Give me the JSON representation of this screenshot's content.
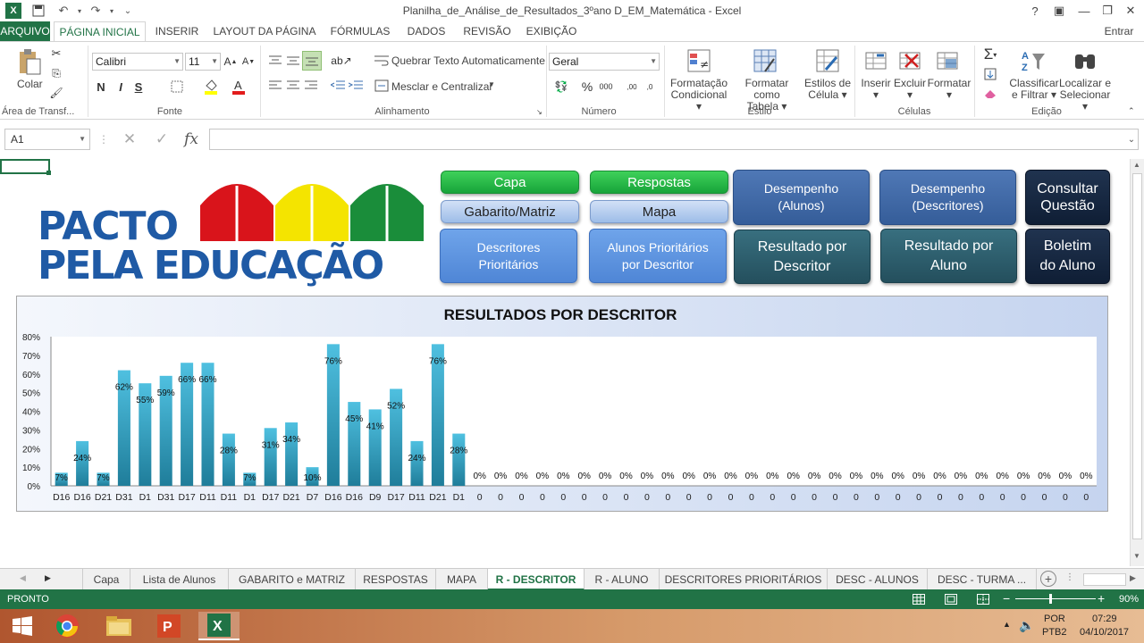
{
  "window": {
    "title": "Planilha_de_Análise_de_Resultados_3ºano D_EM_Matemática - Excel",
    "help": "?",
    "signin": "Entrar"
  },
  "ribbon_tabs": [
    "ARQUIVO",
    "PÁGINA INICIAL",
    "INSERIR",
    "LAYOUT DA PÁGINA",
    "FÓRMULAS",
    "DADOS",
    "REVISÃO",
    "EXIBIÇÃO"
  ],
  "ribbon": {
    "paste": "Colar",
    "font_name": "Calibri",
    "font_size": "11",
    "bold": "N",
    "italic": "I",
    "underline": "S",
    "wrap_text": "Quebrar Texto Automaticamente",
    "merge_center": "Mesclar e Centralizar",
    "number_format": "Geral",
    "percent": "%",
    "thousands": "000",
    "cond_format": [
      "Formatação",
      "Condicional"
    ],
    "format_table": [
      "Formatar como",
      "Tabela"
    ],
    "cell_styles": [
      "Estilos de",
      "Célula"
    ],
    "insert": "Inserir",
    "delete": "Excluir",
    "format": "Formatar",
    "sort_filter": [
      "Classificar",
      "e Filtrar"
    ],
    "find_select": [
      "Localizar e",
      "Selecionar"
    ],
    "groups": [
      "Área de Transf...",
      "Fonte",
      "Alinhamento",
      "Número",
      "Estilo",
      "Células",
      "Edição"
    ]
  },
  "formula_bar": {
    "name_box": "A1",
    "fx": "fx",
    "value": ""
  },
  "logo": {
    "line1": "PACTO",
    "line2": "PELA EDUCAÇÃO"
  },
  "nav_buttons": {
    "capa": "Capa",
    "respostas": "Respostas",
    "gabarito": "Gabarito/Matriz",
    "mapa": "Mapa",
    "desc_prior": [
      "Descritores",
      "Prioritários"
    ],
    "alunos_prior": [
      "Alunos Prioritários",
      "por Descritor"
    ],
    "desemp_alunos": [
      "Desempenho",
      "(Alunos)"
    ],
    "desemp_desc": [
      "Desempenho",
      "(Descritores)"
    ],
    "consultar": [
      "Consultar",
      "Questão"
    ],
    "res_desc": [
      "Resultado por",
      "Descritor"
    ],
    "res_aluno": [
      "Resultado por",
      "Aluno"
    ],
    "boletim": [
      "Boletim",
      "do Aluno"
    ]
  },
  "chart_data": {
    "type": "bar",
    "title": "RESULTADOS POR DESCRITOR",
    "categories": [
      "D16",
      "D16",
      "D21",
      "D31",
      "D1",
      "D31",
      "D17",
      "D11",
      "D11",
      "D1",
      "D17",
      "D21",
      "D7",
      "D16",
      "D16",
      "D9",
      "D17",
      "D11",
      "D21",
      "D1",
      "0",
      "0",
      "0",
      "0",
      "0",
      "0",
      "0",
      "0",
      "0",
      "0",
      "0",
      "0",
      "0",
      "0",
      "0",
      "0",
      "0",
      "0",
      "0",
      "0",
      "0",
      "0",
      "0",
      "0",
      "0",
      "0",
      "0",
      "0",
      "0",
      "0"
    ],
    "values": [
      7,
      24,
      7,
      62,
      55,
      59,
      66,
      66,
      28,
      7,
      31,
      34,
      10,
      76,
      45,
      41,
      52,
      24,
      76,
      28,
      0,
      0,
      0,
      0,
      0,
      0,
      0,
      0,
      0,
      0,
      0,
      0,
      0,
      0,
      0,
      0,
      0,
      0,
      0,
      0,
      0,
      0,
      0,
      0,
      0,
      0,
      0,
      0,
      0,
      0
    ],
    "labels": [
      "7%",
      "24%",
      "7%",
      "62%",
      "55%",
      "59%",
      "66%",
      "66%",
      "28%",
      "7%",
      "31%",
      "34%",
      "10%",
      "76%",
      "45%",
      "41%",
      "52%",
      "24%",
      "76%",
      "28%",
      "0%",
      "0%",
      "0%",
      "0%",
      "0%",
      "0%",
      "0%",
      "0%",
      "0%",
      "0%",
      "0%",
      "0%",
      "0%",
      "0%",
      "0%",
      "0%",
      "0%",
      "0%",
      "0%",
      "0%",
      "0%",
      "0%",
      "0%",
      "0%",
      "0%",
      "0%",
      "0%",
      "0%",
      "0%",
      "0%"
    ],
    "ylim": [
      0,
      80
    ],
    "yticks": [
      "0%",
      "10%",
      "20%",
      "30%",
      "40%",
      "50%",
      "60%",
      "70%",
      "80%"
    ],
    "bar_color": "#3aa7c9",
    "grid": false,
    "legend": "none"
  },
  "sheet_tabs": [
    "Capa",
    "Lista de Alunos",
    "GABARITO e MATRIZ",
    "RESPOSTAS",
    "MAPA",
    "R - DESCRITOR",
    "R - ALUNO",
    "DESCRITORES PRIORITÁRIOS",
    "DESC - ALUNOS",
    "DESC - TURMA ..."
  ],
  "status": {
    "ready": "PRONTO",
    "zoom": "90%"
  },
  "taskbar": {
    "lang1": "POR",
    "lang2": "PTB2",
    "time": "07:29",
    "date": "04/10/2017"
  },
  "colors": {
    "excel_green": "#217346"
  }
}
